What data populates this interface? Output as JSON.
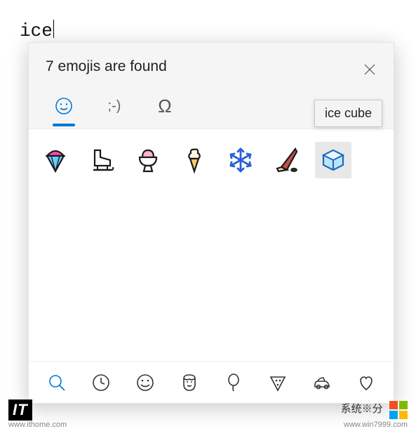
{
  "input": {
    "text": "ice"
  },
  "panel": {
    "found_text": "7 emojis are found",
    "tabs": {
      "kaomoji_label": ";-)",
      "symbol_label": "Ω"
    },
    "tooltip": "ice cube",
    "results": [
      {
        "name": "shaved-ice"
      },
      {
        "name": "ice-skate"
      },
      {
        "name": "ice-cream-bowl"
      },
      {
        "name": "soft-ice-cream"
      },
      {
        "name": "snowflake"
      },
      {
        "name": "ice-hockey"
      },
      {
        "name": "ice-cube"
      }
    ],
    "categories": [
      {
        "name": "search",
        "active": true
      },
      {
        "name": "recent"
      },
      {
        "name": "smileys"
      },
      {
        "name": "people"
      },
      {
        "name": "celebration"
      },
      {
        "name": "food"
      },
      {
        "name": "transport"
      },
      {
        "name": "hearts"
      }
    ]
  },
  "watermarks": {
    "left_logo": "IT",
    "left_url": "www.ithome.com",
    "right_text": "系统※分",
    "right_url": "www.win7999.com"
  }
}
